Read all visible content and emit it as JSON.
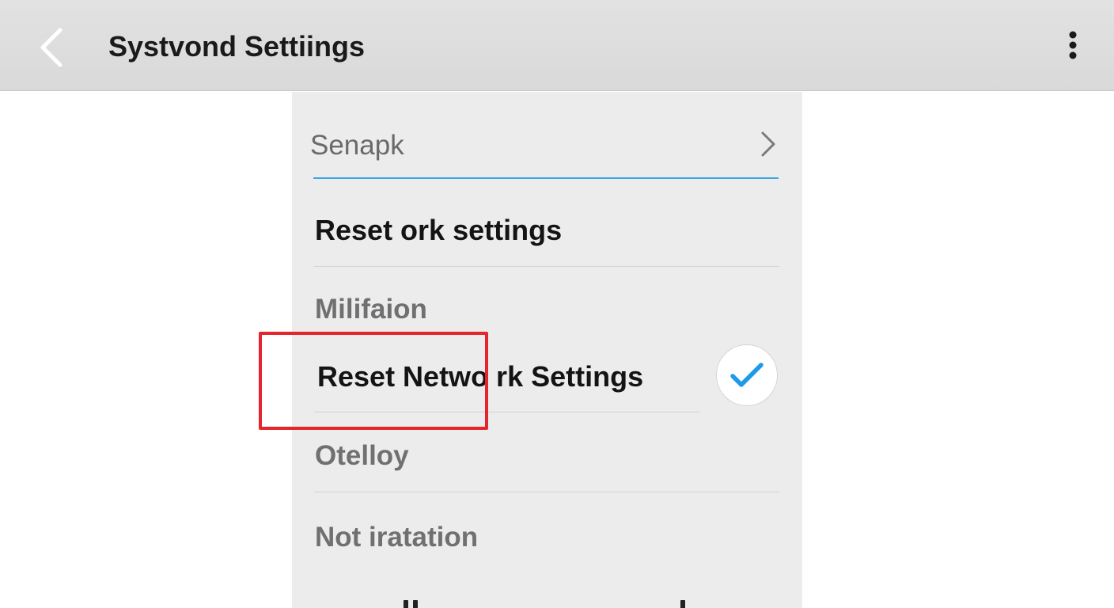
{
  "app_bar": {
    "title": "Systvond Settiings",
    "back_icon": "chevron-left-icon",
    "menu_icon": "more-vertical-icon"
  },
  "search": {
    "text": "Senapk",
    "chevron_icon": "chevron-right-icon",
    "accent_color": "#3fa6e6"
  },
  "items": [
    {
      "label": "Reset  ork settings"
    },
    {
      "label": "Milifaion"
    },
    {
      "label": "Reset  Netwo rk Settings",
      "checked": true,
      "check_color": "#1e9be8"
    },
    {
      "label": "Otelloy"
    },
    {
      "label": "Not iratation"
    }
  ],
  "annotation": {
    "highlight_color": "#e3262d"
  }
}
